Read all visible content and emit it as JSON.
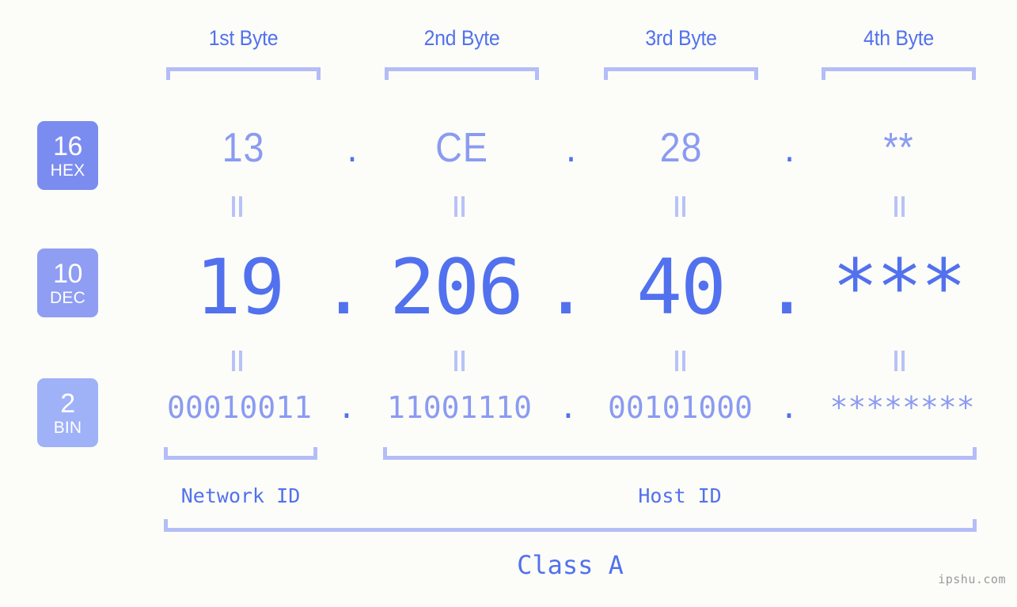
{
  "meta": {
    "background_color": "#fcfdf8",
    "accent_strong": "#5271ee",
    "accent_light": "#8b9bf2",
    "accent_bracket": "#b4bdf7"
  },
  "byte_headers": [
    {
      "label": "1st Byte"
    },
    {
      "label": "2nd Byte"
    },
    {
      "label": "3rd Byte"
    },
    {
      "label": "4th Byte"
    }
  ],
  "badges": [
    {
      "number": "16",
      "abbr": "HEX",
      "color": "#7b8cf0"
    },
    {
      "number": "10",
      "abbr": "DEC",
      "color": "#8f9df3"
    },
    {
      "number": "2",
      "abbr": "BIN",
      "color": "#9fb1f7"
    }
  ],
  "rows": {
    "hex": {
      "values": [
        "13",
        "CE",
        "28",
        "**"
      ],
      "separator": "."
    },
    "dec": {
      "values": [
        "19",
        "206",
        "40",
        "***"
      ],
      "separator": "."
    },
    "bin": {
      "values": [
        "00010011",
        "11001110",
        "00101000",
        "********"
      ],
      "separator": "."
    }
  },
  "equals_symbol": "=",
  "id_labels": [
    {
      "text": "Network ID"
    },
    {
      "text": "Host ID"
    }
  ],
  "class_label": "Class A",
  "watermark": "ipshu.com"
}
